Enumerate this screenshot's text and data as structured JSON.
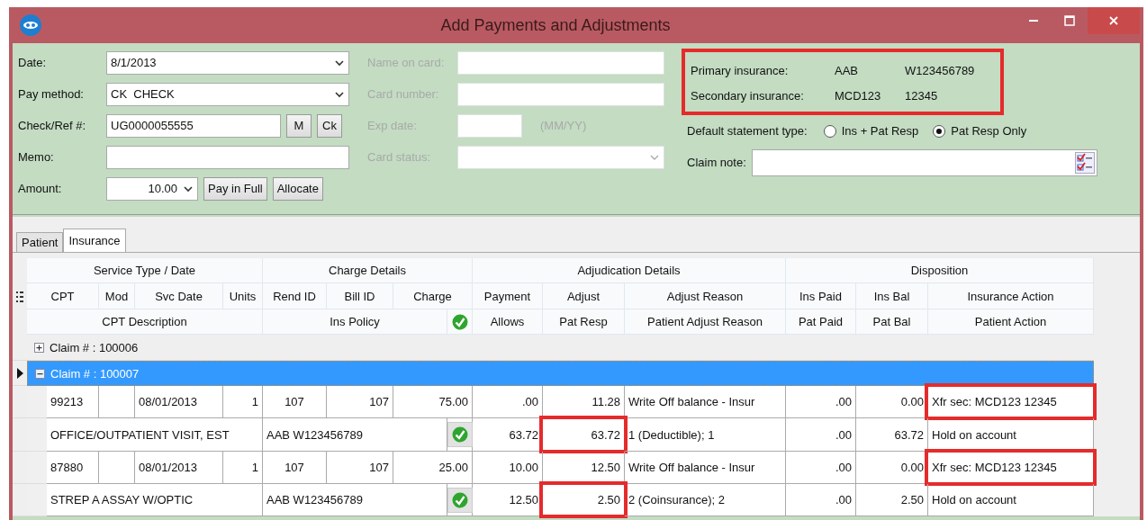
{
  "window": {
    "title": "Add Payments and Adjustments"
  },
  "payment": {
    "date": {
      "label": "Date:",
      "value": "8/1/2013"
    },
    "pay_method": {
      "label": "Pay method:",
      "value": "CK  CHECK"
    },
    "check_ref": {
      "label": "Check/Ref #:",
      "value": "UG0000055555",
      "buttons": [
        "M",
        "Ck"
      ]
    },
    "memo": {
      "label": "Memo:"
    },
    "amount": {
      "label": "Amount:",
      "value": "10.00",
      "buttons": [
        "Pay in Full",
        "Allocate"
      ]
    }
  },
  "card": {
    "disabled": true,
    "name_on_card": {
      "label": "Name on card:"
    },
    "card_number": {
      "label": "Card number:"
    },
    "exp_date": {
      "label": "Exp date:",
      "hint": "(MM/YY)"
    },
    "card_status": {
      "label": "Card status:"
    }
  },
  "insurance": {
    "highlighted": true,
    "rows": [
      {
        "label": "Primary insurance:",
        "plan": "AAB",
        "policy": "W123456789"
      },
      {
        "label": "Secondary insurance:",
        "plan": "MCD123",
        "policy": "12345"
      }
    ]
  },
  "statement_type": {
    "label": "Default statement type:",
    "options": [
      {
        "label": "Ins + Pat Resp",
        "selected": false
      },
      {
        "label": "Pat Resp Only",
        "selected": true
      }
    ]
  },
  "claim_note": {
    "label": "Claim note:"
  },
  "tabs": [
    {
      "label": "Patient",
      "selected": false
    },
    {
      "label": "Insurance",
      "selected": true
    }
  ],
  "grid": {
    "groups": [
      "Service Type / Date",
      "Charge Details",
      "Adjudication Details",
      "Disposition"
    ],
    "header_rows": [
      [
        "CPT",
        "Mod",
        "Svc Date",
        "Units",
        "Rend ID",
        "Bill ID",
        "Charge",
        "Payment",
        "Adjust",
        "Adjust Reason",
        "Ins Paid",
        "Ins Bal",
        "Insurance Action"
      ],
      [
        "CPT Description",
        "Ins Policy",
        "Allows",
        "Pat Resp",
        "Patient Adjust Reason",
        "Pat Paid",
        "Pat Bal",
        "Patient Action"
      ]
    ],
    "claims": [
      {
        "label": "Claim # : 100006",
        "expanded": false,
        "selected": false
      },
      {
        "label": "Claim # : 100007",
        "expanded": true,
        "selected": true,
        "lines": [
          {
            "charge_row": {
              "cpt": "99213",
              "svc_date": "08/01/2013",
              "units": "1",
              "rend_id": "107",
              "bill_id": "107",
              "charge": "75.00",
              "payment": ".00",
              "adjust": "11.28",
              "adjust_reason": "Write Off balance - Insur",
              "ins_paid": ".00",
              "ins_bal": "0.00",
              "insurance_action": {
                "text": "Xfr sec: MCD123 12345",
                "highlighted": true
              }
            },
            "patient_row": {
              "description": "OFFICE/OUTPATIENT VISIT, EST",
              "ins_policy": "AAB W123456789",
              "verified": true,
              "allows": "63.72",
              "pat_resp": {
                "text": "63.72",
                "highlighted": true
              },
              "patient_adjust_reason": "1 (Deductible); 1",
              "pat_paid": ".00",
              "pat_bal": "63.72",
              "patient_action": "Hold on account"
            }
          },
          {
            "charge_row": {
              "cpt": "87880",
              "svc_date": "08/01/2013",
              "units": "1",
              "rend_id": "107",
              "bill_id": "107",
              "charge": "25.00",
              "payment": "10.00",
              "adjust": "12.50",
              "adjust_reason": "Write Off balance - Insur",
              "ins_paid": ".00",
              "ins_bal": "0.00",
              "insurance_action": {
                "text": "Xfr sec: MCD123 12345",
                "highlighted": true
              }
            },
            "patient_row": {
              "description": "STREP A ASSAY W/OPTIC",
              "ins_policy": "AAB W123456789",
              "verified": true,
              "allows": "12.50",
              "pat_resp": {
                "text": "2.50",
                "highlighted": true
              },
              "patient_adjust_reason": "2 (Coinsurance); 2",
              "pat_paid": ".00",
              "pat_bal": "2.50",
              "patient_action": "Hold on account"
            }
          }
        ]
      }
    ]
  }
}
